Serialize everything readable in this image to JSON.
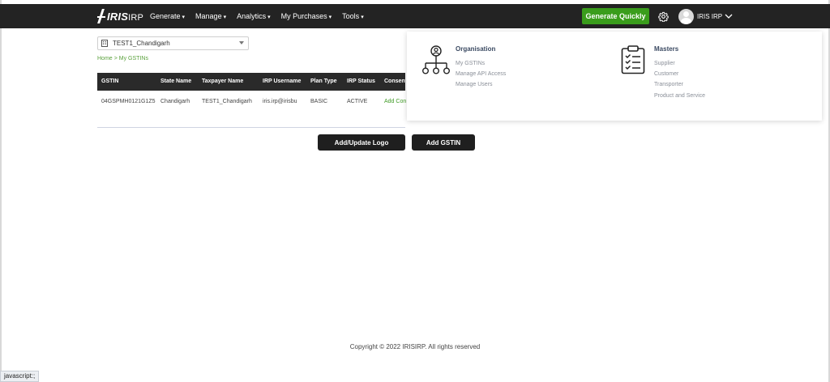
{
  "brand": {
    "logo_main": "IRIS",
    "logo_sub": "IRP"
  },
  "nav": {
    "items": [
      {
        "label": "Generate"
      },
      {
        "label": "Manage"
      },
      {
        "label": "Analytics"
      },
      {
        "label": "My Purchases"
      },
      {
        "label": "Tools"
      }
    ],
    "generate_button": "Generate Quickly",
    "user_name": "IRIS IRP"
  },
  "selector": {
    "value": "TEST1_Chandigarh"
  },
  "breadcrumb": {
    "home": "Home",
    "separator": ">",
    "current": "My GSTINs"
  },
  "table": {
    "headers": [
      "GSTIN",
      "State Name",
      "Taxpayer Name",
      "IRP Username",
      "Plan Type",
      "IRP Status",
      "Consent"
    ],
    "rows": [
      {
        "gstin": "04GSPMH0121G1Z5",
        "state": "Chandigarh",
        "taxpayer": "TEST1_Chandigarh",
        "username": "iris.irp@irisbu",
        "plan": "BASIC",
        "status": "ACTIVE",
        "consent": "Add Con"
      }
    ]
  },
  "actions": {
    "logo_button": "Add/Update Logo",
    "gstin_button": "Add GSTIN"
  },
  "dropdown": {
    "organisation": {
      "title": "Organisation",
      "links": [
        "My GSTINs",
        "Manage API Access",
        "Manage Users"
      ]
    },
    "masters": {
      "title": "Masters",
      "links": [
        "Supplier",
        "Customer",
        "Transporter",
        "Product and Service"
      ]
    }
  },
  "footer": {
    "copyright": "Copyright © 2022 IRISIRP. All rights reserved"
  },
  "status_bar": {
    "text": "javascript:;"
  },
  "colors": {
    "navbar": "#232323",
    "accent_green": "#3a9d1c",
    "table_header": "#2a2a2a",
    "link_green": "#5aa13c"
  }
}
